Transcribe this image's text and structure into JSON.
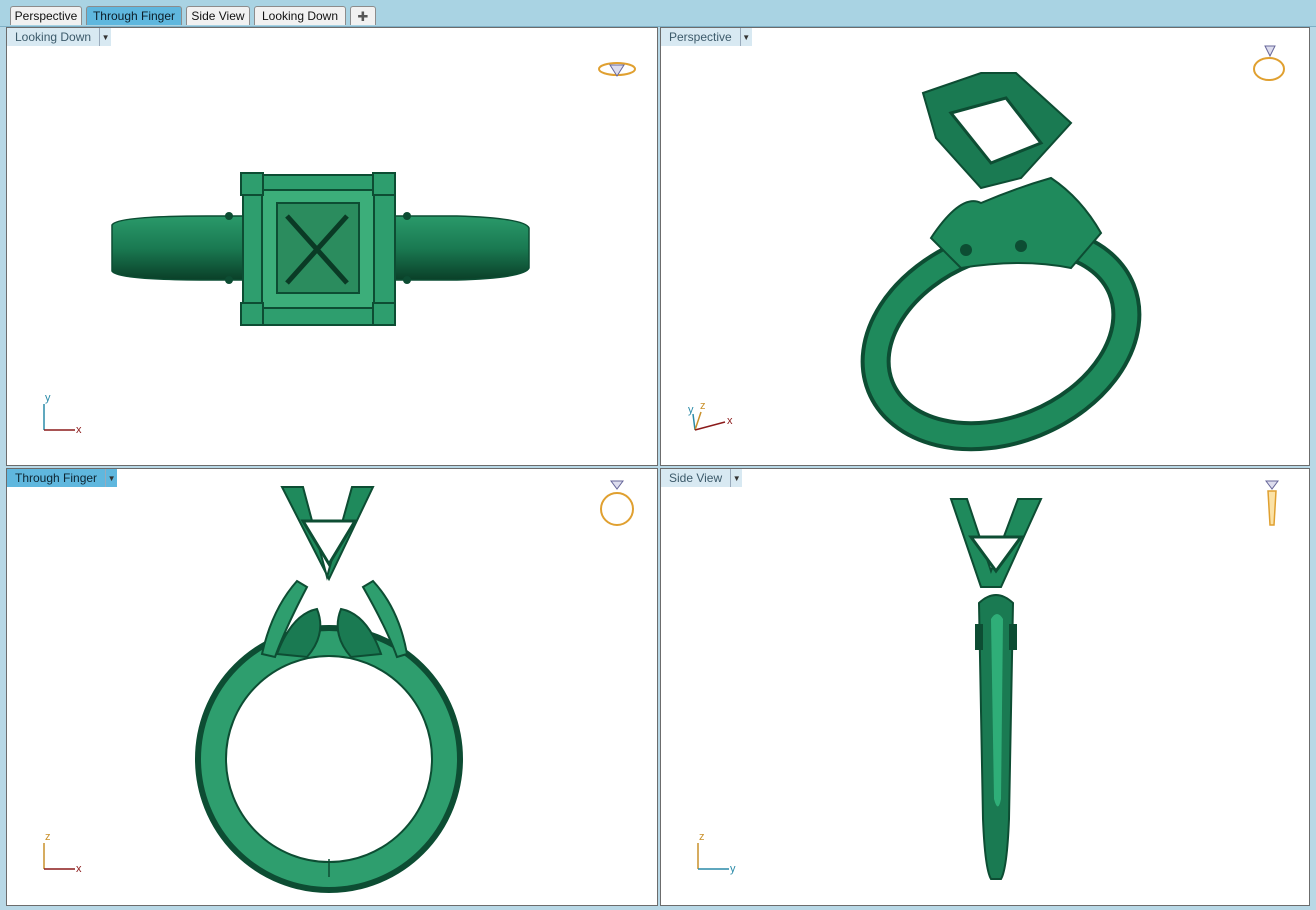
{
  "tabs": [
    "Perspective",
    "Through Finger",
    "Side View",
    "Looking Down"
  ],
  "active_tab": "Through Finger",
  "add_tab_icon": "plus-icon",
  "viewports": {
    "top_left": {
      "label": "Looking Down",
      "axis_a": "y",
      "axis_b": "x"
    },
    "top_right": {
      "label": "Perspective",
      "axis_a": "y",
      "axis_b": "z",
      "axis_c": "x"
    },
    "bottom_left": {
      "label": "Through Finger",
      "axis_a": "z",
      "axis_b": "x"
    },
    "bottom_right": {
      "label": "Side View",
      "axis_a": "z",
      "axis_b": "y"
    }
  },
  "colors": {
    "model": "#1f8a5c",
    "model_dark": "#0d4d33",
    "active_label": "#5fb7de",
    "axis_x": "#8b1a1a",
    "axis_y": "#2a8aa8",
    "axis_z": "#c9902a"
  }
}
